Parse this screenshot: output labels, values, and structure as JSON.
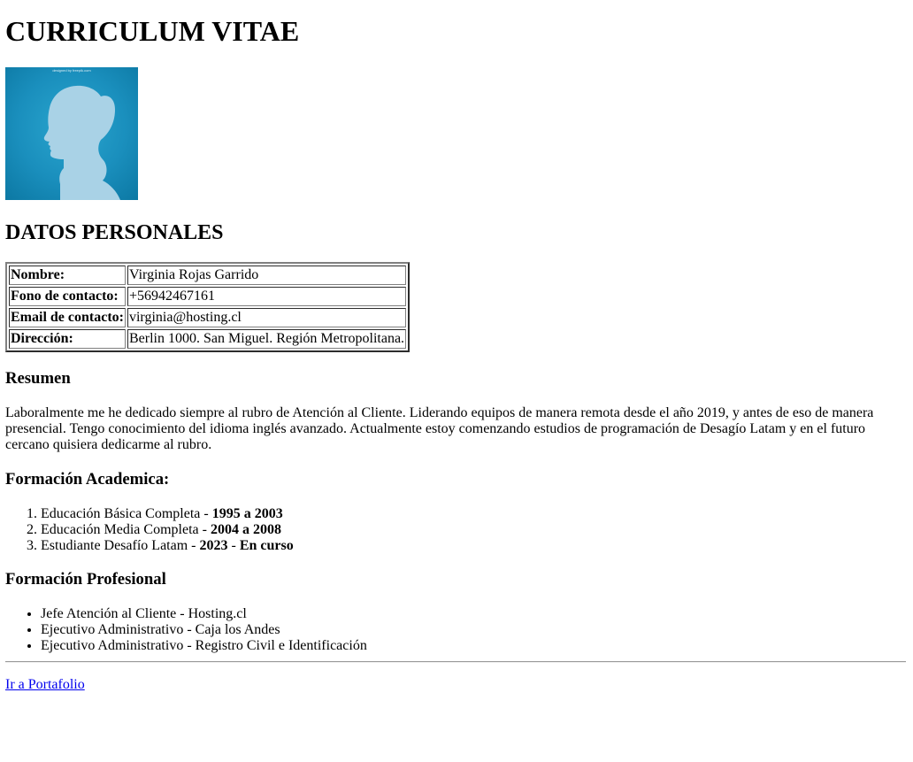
{
  "header": {
    "title": "CURRICULUM VITAE"
  },
  "photo": {
    "watermark": "designed by freepik.com"
  },
  "personal": {
    "heading": "DATOS PERSONALES",
    "rows": [
      {
        "label": "Nombre:",
        "value": "Virginia Rojas Garrido"
      },
      {
        "label": "Fono de contacto:",
        "value": "+56942467161"
      },
      {
        "label": "Email de contacto:",
        "value": "virginia@hosting.cl"
      },
      {
        "label": "Dirección:",
        "value": "Berlin 1000. San Miguel. Región Metropolitana."
      }
    ]
  },
  "resumen": {
    "heading": "Resumen",
    "text": "Laboralmente me he dedicado siempre al rubro de Atención al Cliente. Liderando equipos de manera remota desde el año 2019, y antes de eso de manera presencial. Tengo conocimiento del idioma inglés avanzado. Actualmente estoy comenzando estudios de programación de Desagío Latam y en el futuro cercano quisiera dedicarme al rubro."
  },
  "academica": {
    "heading": "Formación Academica:",
    "items": [
      {
        "text": "Educación Básica Completa - ",
        "bold": "1995 a 2003",
        "text2": "",
        "bold2": ""
      },
      {
        "text": "Educación Media Completa - ",
        "bold": "2004 a 2008",
        "text2": "",
        "bold2": ""
      },
      {
        "text": "Estudiante Desafío Latam - ",
        "bold": "2023",
        "text2": " - ",
        "bold2": "En curso"
      }
    ]
  },
  "profesional": {
    "heading": "Formación Profesional",
    "items": [
      "Jefe Atención al Cliente - Hosting.cl",
      "Ejecutivo Administrativo - Caja los Andes",
      "Ejecutivo Administrativo - Registro Civil e Identificación"
    ]
  },
  "footer": {
    "link_label": "Ir a Portafolio"
  }
}
